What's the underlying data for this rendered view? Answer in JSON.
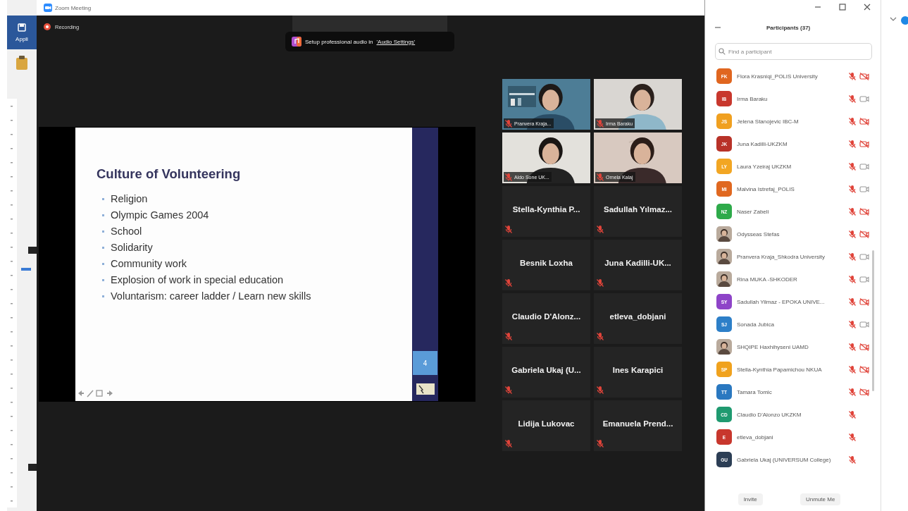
{
  "app_behind": {
    "ribbon_label": "Appli"
  },
  "window": {
    "title": "Zoom Meeting"
  },
  "recording": {
    "label": "Recording"
  },
  "notification": {
    "text": "Setup professional audio in",
    "link": "'Audio Settings'"
  },
  "slide": {
    "title": "Culture of Volunteering",
    "bullets": [
      "Religion",
      "Olympic Games 2004",
      "School",
      "Solidarity",
      "Community work",
      "Explosion of work in special education",
      "Voluntarism: career ladder / Learn new skills"
    ],
    "page": "4"
  },
  "video_tiles": [
    {
      "kind": "video",
      "name": "Pranvera Kraja...",
      "muted": true
    },
    {
      "kind": "video",
      "name": "Irma Baraku",
      "muted": true
    },
    {
      "kind": "video",
      "name": "Aldo Sone UK...",
      "muted": true
    },
    {
      "kind": "video",
      "name": "Ornela Kalaj",
      "muted": true
    },
    {
      "kind": "name",
      "name": "Stella-Kynthia P...",
      "muted": true
    },
    {
      "kind": "name",
      "name": "Sadullah Yılmaz...",
      "muted": true
    },
    {
      "kind": "name",
      "name": "Besnik Loxha",
      "muted": true
    },
    {
      "kind": "name",
      "name": "Juna Kadilli-UK...",
      "muted": true
    },
    {
      "kind": "name",
      "name": "Claudio D'Alonz...",
      "muted": true
    },
    {
      "kind": "name",
      "name": "etleva_dobjani",
      "muted": true
    },
    {
      "kind": "name",
      "name": "Gabriela Ukaj (U...",
      "muted": true
    },
    {
      "kind": "name",
      "name": "Ines Karapici",
      "muted": true
    },
    {
      "kind": "name",
      "name": "Lidija Lukovac",
      "muted": true
    },
    {
      "kind": "name",
      "name": "Emanuela Prend...",
      "muted": true
    }
  ],
  "participants_panel": {
    "title": "Participants (37)",
    "search": {
      "placeholder": "Find a participant"
    },
    "participants": [
      {
        "kind": "initials",
        "initials": "FK",
        "color": "#e0661f",
        "name": "Flora Krasniqi_POLIS University",
        "muted": true,
        "video_off": true
      },
      {
        "kind": "initials",
        "initials": "IB",
        "color": "#c8372d",
        "name": "Irma Baraku",
        "muted": true,
        "video_off": false
      },
      {
        "kind": "initials",
        "initials": "JS",
        "color": "#f0a020",
        "name": "Jelena Stanojevic IBC-M",
        "muted": true,
        "video_off": true
      },
      {
        "kind": "initials",
        "initials": "JK",
        "color": "#b83228",
        "name": "Juna Kadilli-UKZKM",
        "muted": true,
        "video_off": true
      },
      {
        "kind": "initials",
        "initials": "LY",
        "color": "#f2a623",
        "name": "Laura Yzeiraj UKZKM",
        "muted": true,
        "video_off": false
      },
      {
        "kind": "initials",
        "initials": "MI",
        "color": "#e06820",
        "name": "Malvina Istrefaj_POLIS",
        "muted": true,
        "video_off": false
      },
      {
        "kind": "initials",
        "initials": "NZ",
        "color": "#2eaa4a",
        "name": "Naser Zabeli",
        "muted": true,
        "video_off": true
      },
      {
        "kind": "picture",
        "name": "Odysseas Stefas",
        "muted": true,
        "video_off": true
      },
      {
        "kind": "picture",
        "name": "Pranvera Kraja_Shkodra University",
        "muted": true,
        "video_off": false
      },
      {
        "kind": "picture",
        "name": "Rina MUKA -SHKODER",
        "muted": true,
        "video_off": false
      },
      {
        "kind": "initials",
        "initials": "SY",
        "color": "#8e44c8",
        "name": "Sadullah Yilmaz - EPOKA UNIVE...",
        "muted": true,
        "video_off": true
      },
      {
        "kind": "initials",
        "initials": "SJ",
        "color": "#2d7fc8",
        "name": "Sonada Jubica",
        "muted": true,
        "video_off": false
      },
      {
        "kind": "picture",
        "name": "SHQIPE Haxhihyseni UAMD",
        "muted": true,
        "video_off": true
      },
      {
        "kind": "initials",
        "initials": "SP",
        "color": "#f0a21e",
        "name": "Stella-Kynthia Papamichou NKUA",
        "muted": true,
        "video_off": true
      },
      {
        "kind": "initials",
        "initials": "TT",
        "color": "#2a78c0",
        "name": "Tamara Tomic",
        "muted": true,
        "video_off": true
      },
      {
        "kind": "initials",
        "initials": "CD",
        "color": "#1f9a70",
        "name": "Claudio D'Alonzo UKZKM",
        "muted": true
      },
      {
        "kind": "initials",
        "initials": "E",
        "color": "#c8372d",
        "name": "etleva_dobjani",
        "muted": true
      },
      {
        "kind": "initials",
        "initials": "GU",
        "color": "#2c3e55",
        "name": "Gabriela Ukaj (UNIVERSUM College)",
        "muted": true
      }
    ],
    "buttons": [
      "Invite",
      "Unmute Me"
    ]
  }
}
